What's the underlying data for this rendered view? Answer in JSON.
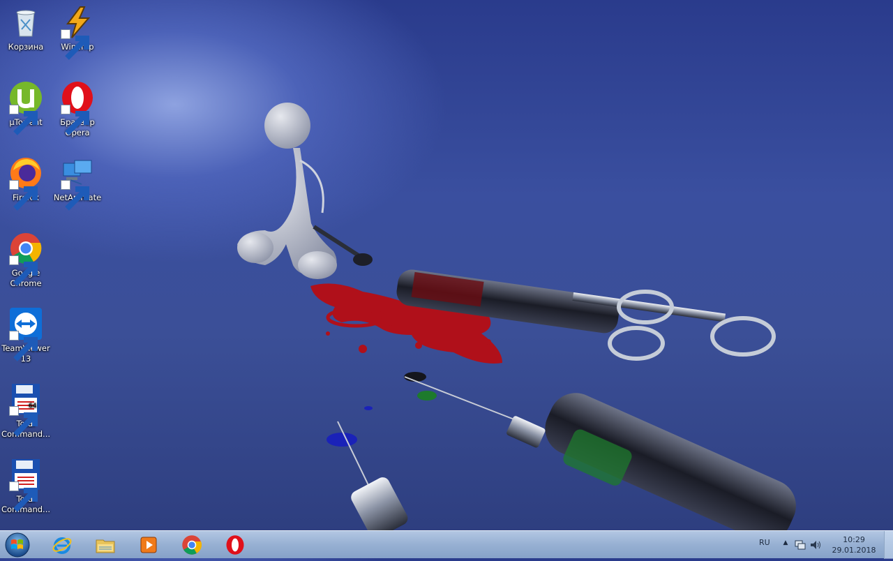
{
  "desktop": {
    "icons": [
      {
        "label": "Корзина",
        "icon": "recycle-bin-icon"
      },
      {
        "label": "Winamp",
        "icon": "winamp-icon"
      },
      {
        "label": "µTorrent",
        "icon": "utorrent-icon"
      },
      {
        "label": "Браузер Opera",
        "icon": "opera-icon"
      },
      {
        "label": "Firefox",
        "icon": "firefox-icon"
      },
      {
        "label": "NetAnimate",
        "icon": "netanimate-icon"
      },
      {
        "label": "Google Chrome",
        "icon": "chrome-icon"
      },
      {
        "label": "TeamViewer 13",
        "icon": "teamviewer-icon"
      },
      {
        "label": "Total Command...",
        "icon": "total-commander-64-icon"
      },
      {
        "label": "Total Command...",
        "icon": "total-commander-icon"
      }
    ]
  },
  "taskbar": {
    "pinned": [
      {
        "icon": "internet-explorer-icon"
      },
      {
        "icon": "file-explorer-icon"
      },
      {
        "icon": "media-player-icon"
      },
      {
        "icon": "chrome-icon"
      },
      {
        "icon": "opera-icon"
      }
    ],
    "tray": {
      "language": "RU",
      "time": "10:29",
      "date": "29.01.2018"
    }
  },
  "colors": {
    "wallpaper_base": "#3b4f97",
    "taskbar": "#a8bfdc",
    "blood_red": "#b0101a",
    "syringe_green": "#1d7a2c"
  }
}
